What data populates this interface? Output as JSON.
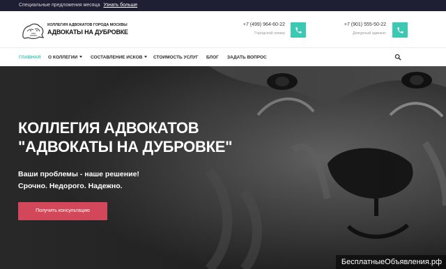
{
  "topbar": {
    "text": "Специальные предложения месяца",
    "link": "Узнать больше"
  },
  "logo": {
    "small_text": "КОЛЛЕГИЯ АДВОКАТОВ ГОРОДА МОСКВЫ",
    "big_text": "АДВОКАТЫ НА ДУБРОВКЕ"
  },
  "phones": [
    {
      "number": "+7 (499) 964-60-22",
      "label": "Городской номер",
      "icon": "phone-icon"
    },
    {
      "number": "+7 (901) 555-50-22",
      "label": "Дежурный адвокат",
      "icon": "phone-icon"
    }
  ],
  "nav": {
    "items": [
      {
        "label": "ГЛАВНАЯ",
        "active": true,
        "dropdown": false
      },
      {
        "label": "О КОЛЛЕГИИ",
        "active": false,
        "dropdown": true
      },
      {
        "label": "СОСТАВЛЕНИЕ ИСКОВ",
        "active": false,
        "dropdown": true
      },
      {
        "label": "СТОИМОСТЬ УСЛУГ",
        "active": false,
        "dropdown": false
      },
      {
        "label": "БЛОГ",
        "active": false,
        "dropdown": false
      },
      {
        "label": "ЗАДАТЬ ВОПРОС",
        "active": false,
        "dropdown": false
      }
    ],
    "search_icon": "search-icon"
  },
  "hero": {
    "title_line1": "КОЛЛЕГИЯ АДВОКАТОВ",
    "title_line2": "\"АДВОКАТЫ НА ДУБРОВКЕ\"",
    "subtitle_line1": "Ваши проблемы - наше решение!",
    "subtitle_line2": "Срочно. Недорого. Надежно.",
    "cta_label": "Получить консультацию"
  },
  "watermark": "БесплатныеОбъявления.рф",
  "colors": {
    "accent": "#3cc9b3",
    "cta": "#d2475a",
    "topbar": "#1f1f33"
  }
}
